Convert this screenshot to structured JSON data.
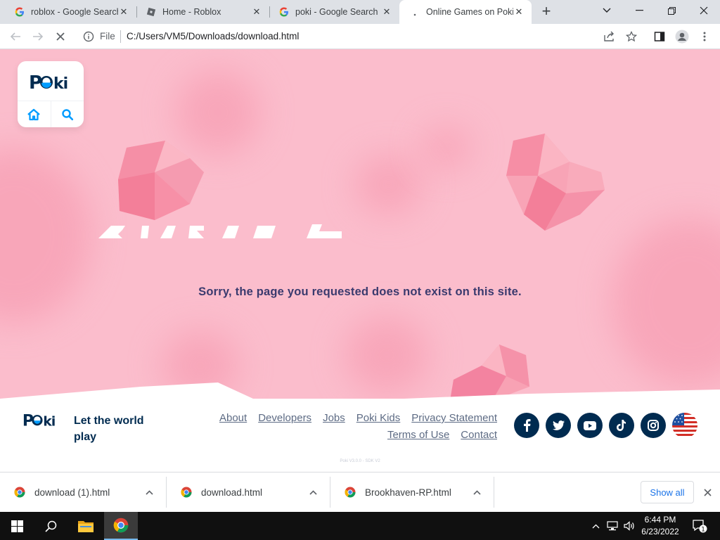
{
  "browser": {
    "tabs": [
      {
        "title": "roblox - Google Search",
        "icon": "google-g-icon",
        "active": false
      },
      {
        "title": "Home - Roblox",
        "icon": "roblox-icon",
        "active": false
      },
      {
        "title": "poki - Google Search",
        "icon": "google-g-icon",
        "active": false
      },
      {
        "title": "Online Games on Poki",
        "icon": "loading-icon",
        "active": true
      }
    ],
    "address_prefix": "File",
    "url": "C:/Users/VM5/Downloads/download.html"
  },
  "page": {
    "brand": "Poki",
    "error_message": "Sorry, the page you requested does not exist on this site.",
    "footer": {
      "tagline": "Let the world play",
      "links_row1": [
        "About",
        "Developers",
        "Jobs",
        "Poki Kids",
        "Privacy Statement"
      ],
      "links_row2": [
        "Terms of Use",
        "Contact"
      ],
      "socials": [
        "facebook-icon",
        "twitter-icon",
        "youtube-icon",
        "tiktok-icon",
        "instagram-icon"
      ],
      "language_flag": "us-flag-icon",
      "version": "Poki V3.0.0 - SDK V2"
    },
    "colors": {
      "hero_pink": "#fbbdcc",
      "navy": "#002b50",
      "accent_blue": "#009cff"
    }
  },
  "downloads": {
    "items": [
      "download (1).html",
      "download.html",
      "Brookhaven-RP.html"
    ],
    "show_all_label": "Show all"
  },
  "taskbar": {
    "time": "6:44 PM",
    "date": "6/23/2022",
    "notification_count": "1"
  }
}
